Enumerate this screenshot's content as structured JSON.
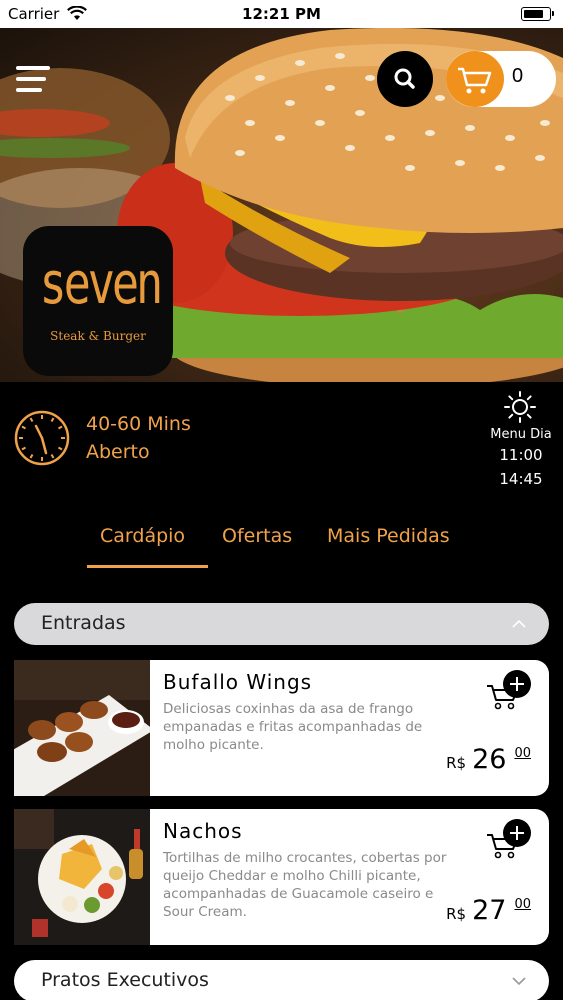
{
  "status_bar": {
    "carrier": "Carrier",
    "time": "12:21 PM"
  },
  "header": {
    "cart_count": "0",
    "accent_color": "#f0911c",
    "icons": [
      "menu-icon",
      "search-icon",
      "cart-icon"
    ]
  },
  "brand": {
    "logo_word": "seven",
    "logo_subtitle": "Steak & Burger"
  },
  "info": {
    "delivery_time": "40-60 Mins",
    "status": "Aberto",
    "menu_label": "Menu Dia",
    "menu_start": "11:00",
    "menu_end": "14:45"
  },
  "tabs": [
    {
      "label": "Cardápio",
      "active": true
    },
    {
      "label": "Ofertas",
      "active": false
    },
    {
      "label": "Mais Pedidas",
      "active": false
    }
  ],
  "sections": [
    {
      "title": "Entradas",
      "expanded": true,
      "items": [
        {
          "name": "Bufallo Wings",
          "description": "Deliciosas coxinhas da asa de frango empanadas e fritas acompanhadas de molho picante.",
          "currency": "R$",
          "price_int": "26",
          "price_dec": "00"
        },
        {
          "name": "Nachos",
          "description": "Tortilhas de milho crocantes, cobertas por queijo Cheddar e molho Chilli picante, acompanhadas de Guacamole caseiro e Sour Cream.",
          "currency": "R$",
          "price_int": "27",
          "price_dec": "00"
        }
      ]
    },
    {
      "title": "Pratos Executivos",
      "expanded": false
    }
  ]
}
